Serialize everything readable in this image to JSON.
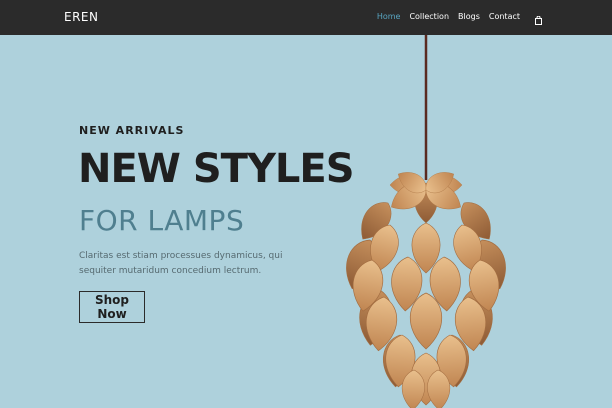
{
  "brand": "EREN",
  "nav": {
    "items": [
      {
        "label": "Home",
        "active": true
      },
      {
        "label": "Collection",
        "active": false
      },
      {
        "label": "Blogs",
        "active": false
      },
      {
        "label": "Contact",
        "active": false
      }
    ],
    "cart_icon": "shopping-bag-icon"
  },
  "hero": {
    "kicker": "NEW ARRIVALS",
    "headline": "NEW STYLES",
    "subhead": "FOR LAMPS",
    "description": "Claritas est stiam processues dynamicus, qui sequiter mutaridum concedium lectrum.",
    "cta_label": "Shop Now"
  },
  "colors": {
    "background": "#aed1dc",
    "navbar": "#2b2b2b",
    "accent": "#58a4c0",
    "subhead": "#4f7f8f",
    "lamp_wood": "#d9a774"
  }
}
